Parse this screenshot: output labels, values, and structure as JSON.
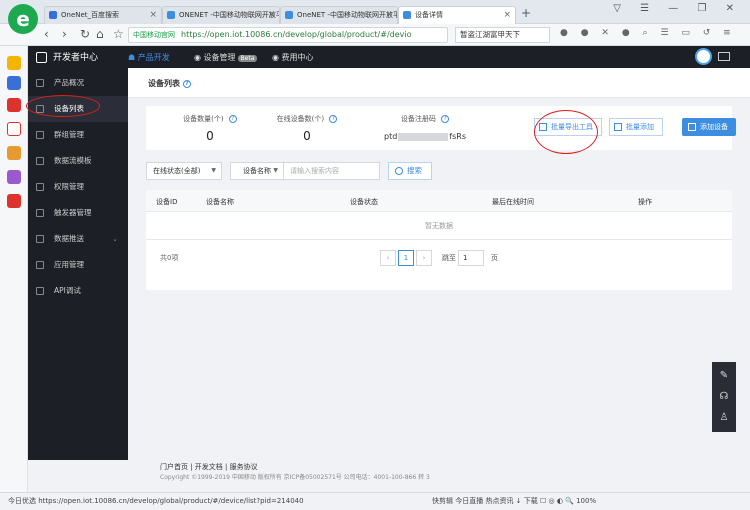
{
  "browser": {
    "tabs": [
      {
        "label": "OneNet_百度搜索",
        "fav": "#2f6fde"
      },
      {
        "label": "ONENET -中国移动物联网开放平",
        "fav": "#3d8de0"
      },
      {
        "label": "OneNET -中国移动物联网开放平",
        "fav": "#3d8de0"
      },
      {
        "label": "设备详情",
        "fav": "#3d8de0"
      }
    ],
    "close_glyph": "×",
    "new_tab_glyph": "+",
    "window_buttons": "▽ ☰ — ❐ ✕",
    "secure_label": "中国移动官网",
    "url": "https://open.iot.10086.cn/develop/global/product/#/devio",
    "search_text": "暂盗江湖富甲天下",
    "nav_back": "‹",
    "nav_forward": "›",
    "nav_reload": "↻",
    "nav_home": "⌂",
    "nav_star": "☆"
  },
  "header": {
    "brand": "开发者中心",
    "nav": [
      {
        "label": "产品开发",
        "active": true
      },
      {
        "label": "设备管理",
        "badge": "Beta"
      },
      {
        "label": "费用中心"
      }
    ]
  },
  "sidebar": {
    "items": [
      {
        "label": "产品概况"
      },
      {
        "label": "设备列表",
        "active": true
      },
      {
        "label": "群组管理"
      },
      {
        "label": "数据流模板"
      },
      {
        "label": "权限管理"
      },
      {
        "label": "触发器管理"
      },
      {
        "label": "数据推送",
        "chevron": "⌄"
      },
      {
        "label": "应用管理"
      },
      {
        "label": "API调试"
      }
    ]
  },
  "main": {
    "title": "设备列表",
    "stats": [
      {
        "label": "设备数量(个)",
        "value": "0"
      },
      {
        "label": "在线设备数(个)",
        "value": "0"
      }
    ],
    "regcode": {
      "label": "设备注册码",
      "prefix": "ptd",
      "suffix": "fsRs"
    },
    "buttons": {
      "export": "批量导出工具",
      "batch_add": "批量添加",
      "add_device": "添加设备"
    },
    "filters": {
      "status": "在线状态(全部)",
      "field": "设备名称",
      "search_placeholder": "请输入搜索内容",
      "search_button": "搜索"
    },
    "table": {
      "columns": [
        "设备ID",
        "设备名称",
        "设备状态",
        "最后在线时间",
        "操作"
      ],
      "empty": "暂无数据",
      "total": "共0项",
      "page_current": "1",
      "prev": "‹",
      "next": "›",
      "goto_label": "跳至",
      "goto_value": "1",
      "page_suffix": "页"
    }
  },
  "footer": {
    "links": "门户首页 | 开发文档 | 服务协议",
    "copyright": "Copyright ©1999-2019 中国移动 版权所有 京ICP备05002571号 公司电话：4001-100-866 转 3"
  },
  "statusbar": {
    "left": "今日优选  https://open.iot.10086.cn/develop/global/product/#/device/list?pid=214040",
    "right": "快剪辑   今日直播   热点资讯   ↓ 下载   ☐ ◎ ◐ 🔍 100%"
  },
  "colors": {
    "accent": "#3d8de0",
    "header_bg": "#1d1f26",
    "annotation": "#e02020"
  }
}
